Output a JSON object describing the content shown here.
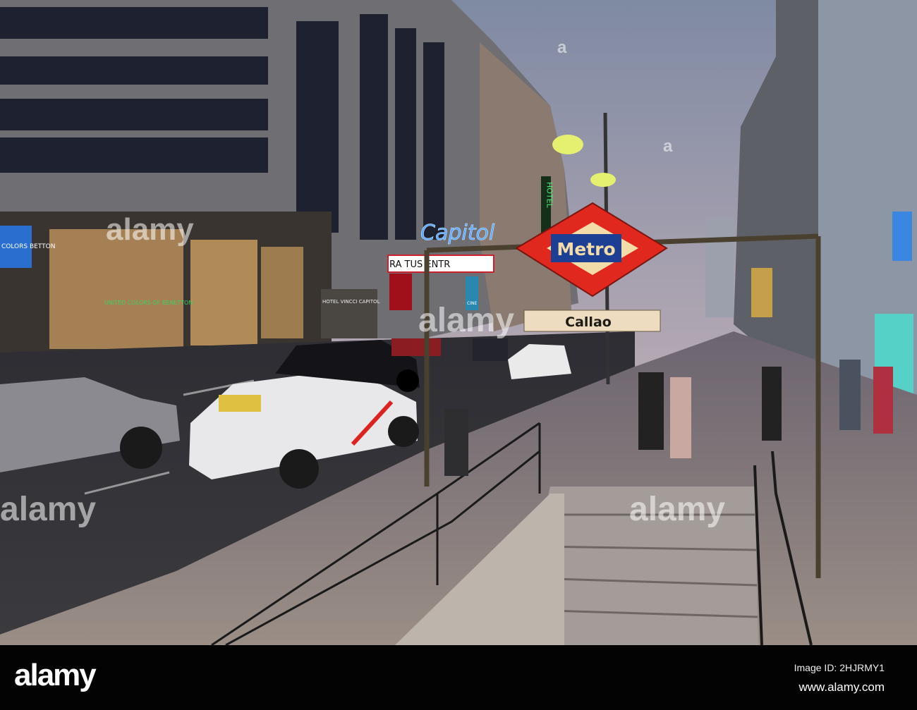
{
  "photo": {
    "metro_sign": "Metro",
    "station_sign": "Callao",
    "neon_sign": "Capitol",
    "hotel_vertical_sign": "HOTEL",
    "hotel_name": "HOTEL VINCCI CAPITOL",
    "billboard_text": "RA TUS ENTR",
    "store_sign": "UNITED COLORS OF BENETTON",
    "store_sign_left": "COLORS BETTON",
    "cine_sign": "CINE",
    "watermarks": [
      "alamy",
      "a"
    ]
  },
  "footer": {
    "logo": "alamy",
    "image_id": "Image ID: 2HJRMY1",
    "website": "www.alamy.com"
  },
  "colors": {
    "metro_red": "#e0281e",
    "metro_blue": "#1c3f94",
    "metro_cream": "#f3dca8",
    "neon_blue": "#5aa8ff"
  }
}
